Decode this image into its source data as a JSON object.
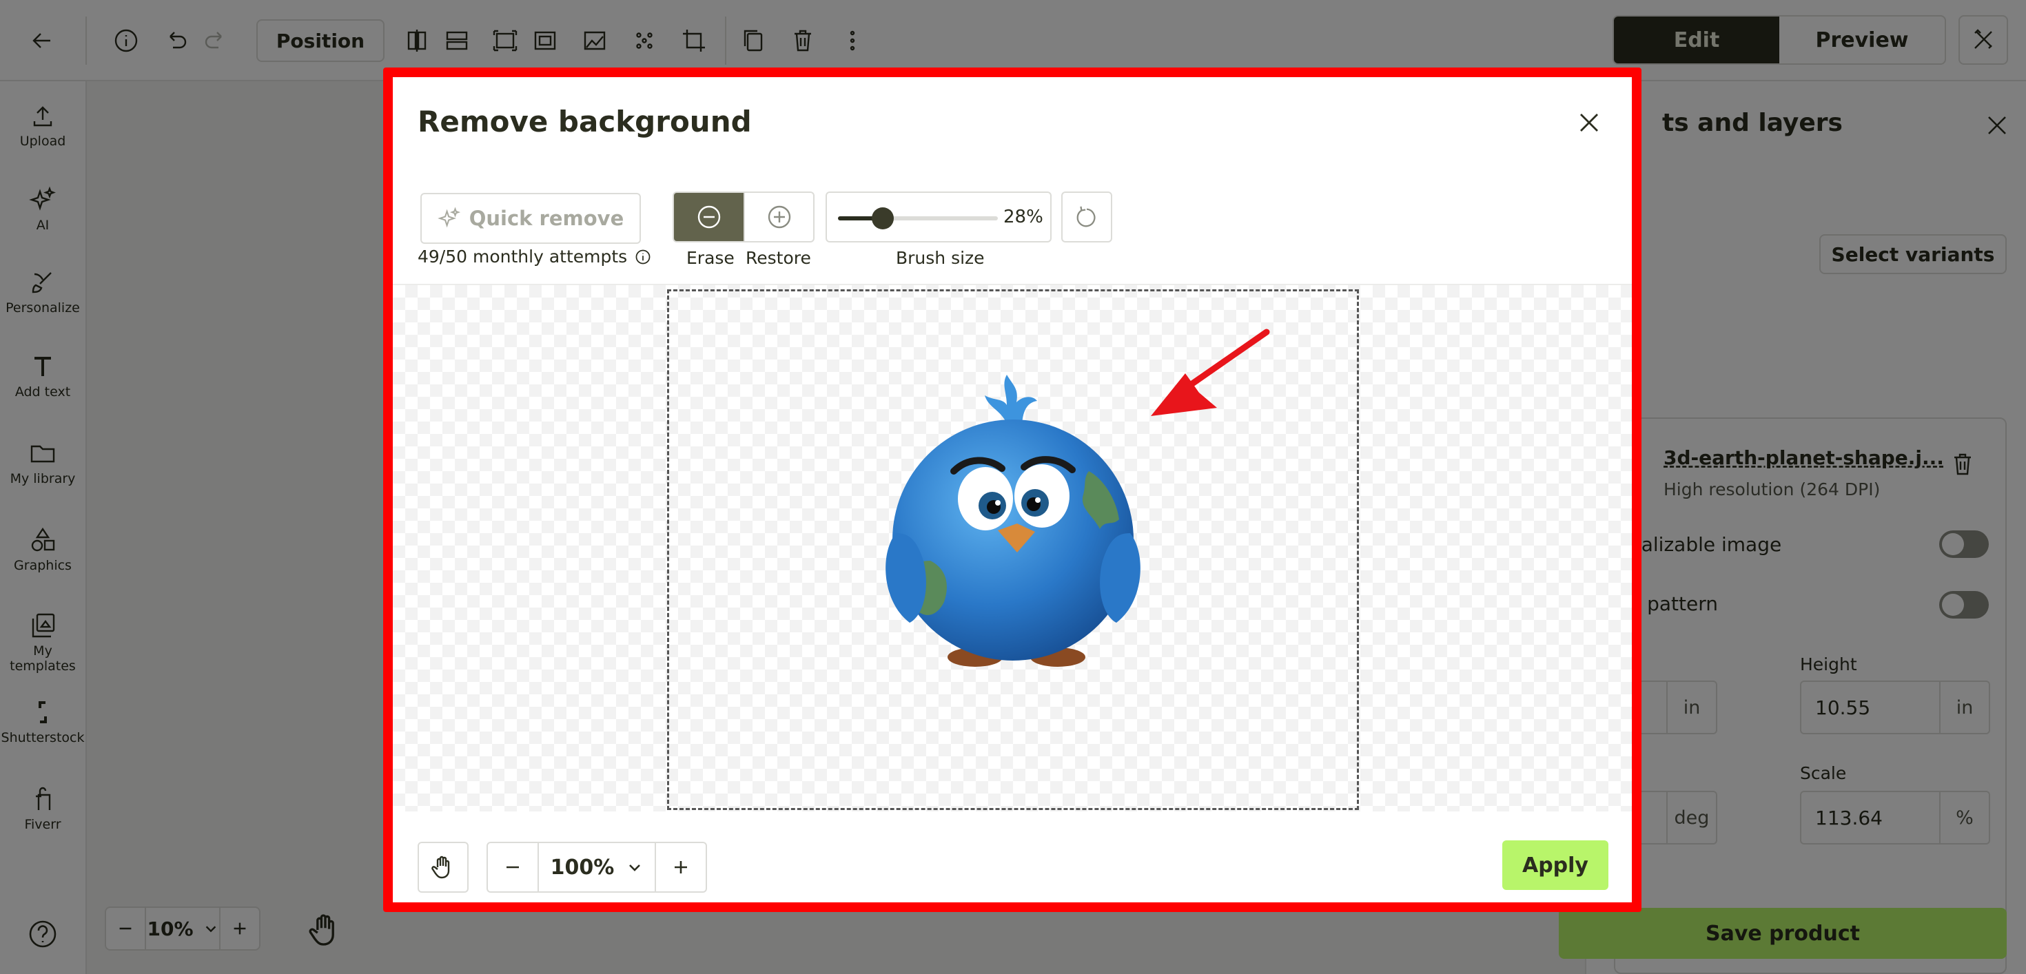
{
  "topbar": {
    "position_label": "Position",
    "edit_label": "Edit",
    "preview_label": "Preview"
  },
  "sidebar": {
    "items": [
      {
        "label": "Upload",
        "icon": "upload-icon"
      },
      {
        "label": "AI",
        "icon": "sparkle-icon"
      },
      {
        "label": "Personalize",
        "icon": "brush-icon"
      },
      {
        "label": "Add text",
        "icon": "text-icon"
      },
      {
        "label": "My library",
        "icon": "folder-icon"
      },
      {
        "label": "Graphics",
        "icon": "shapes-icon"
      },
      {
        "label": "My templates",
        "icon": "templates-icon"
      },
      {
        "label": "Shutterstock",
        "icon": "shutterstock-icon"
      },
      {
        "label": "Fiverr",
        "icon": "fiverr-icon"
      }
    ]
  },
  "canvas": {
    "zoom_value": "10%"
  },
  "right_panel": {
    "title": "ts and layers",
    "select_variants": "Select variants",
    "file_name": "3d-earth-planet-shape.j...",
    "file_resolution": "High resolution (264 DPI)",
    "personalizable_label": "nalizable image",
    "pattern_label": "e pattern",
    "height_label": "Height",
    "height_value": "10.55",
    "height_unit": "in",
    "width_unit": "in",
    "scale_label": "Scale",
    "scale_value": "113.64",
    "scale_unit": "%",
    "rotation_unit": "deg",
    "save_product": "Save product"
  },
  "modal": {
    "title": "Remove background",
    "quick_remove": "Quick remove",
    "attempts": "49/50 monthly attempts",
    "erase_label": "Erase",
    "restore_label": "Restore",
    "brush_size_label": "Brush size",
    "brush_size_value": "28%",
    "brush_size_fraction": 0.28,
    "zoom_value": "100%",
    "apply_label": "Apply"
  },
  "colors": {
    "accent_green": "#b8f56a",
    "dark": "#2b2d1f",
    "highlight_red": "#ff0000",
    "annotation_arrow": "#e8151b"
  }
}
